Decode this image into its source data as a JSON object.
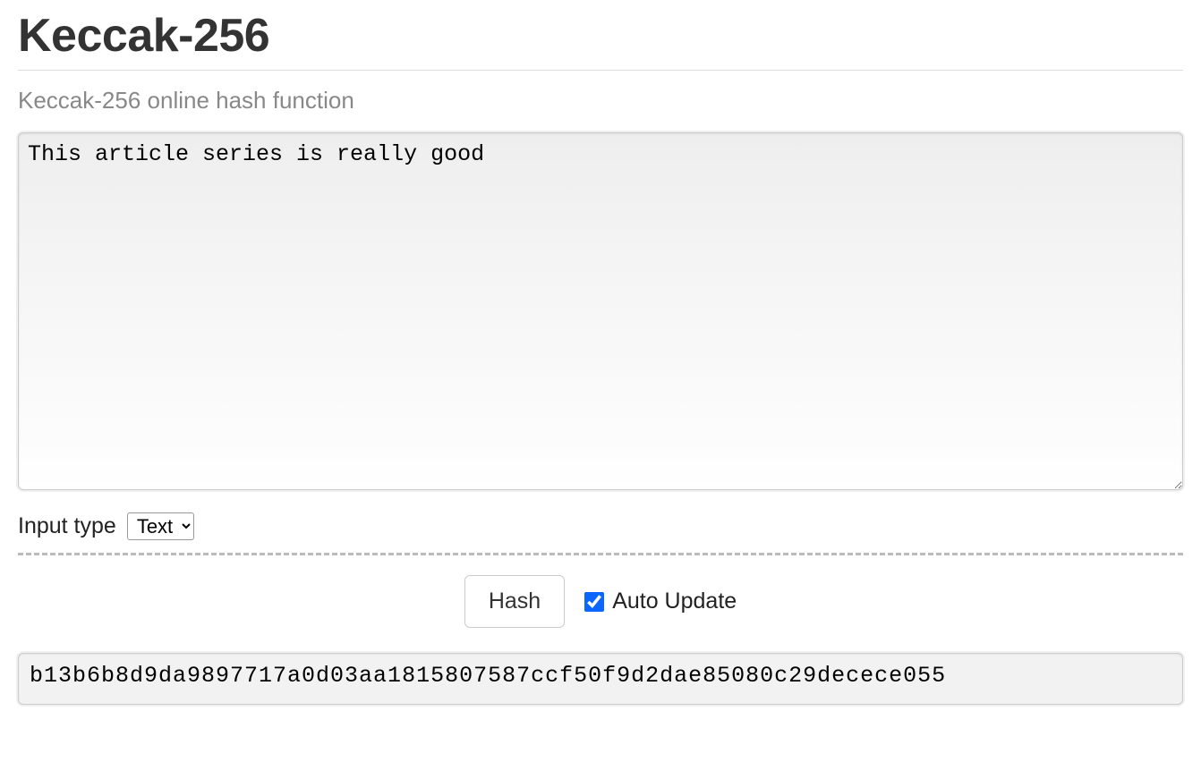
{
  "header": {
    "title": "Keccak-256",
    "subtitle": "Keccak-256 online hash function"
  },
  "input": {
    "value": "This article series is really good"
  },
  "input_type": {
    "label": "Input type",
    "selected": "Text"
  },
  "controls": {
    "hash_button_label": "Hash",
    "auto_update_label": "Auto Update",
    "auto_update_checked": true
  },
  "output": {
    "hash": "b13b6b8d9da9897717a0d03aa1815807587ccf50f9d2dae85080c29decece055"
  }
}
